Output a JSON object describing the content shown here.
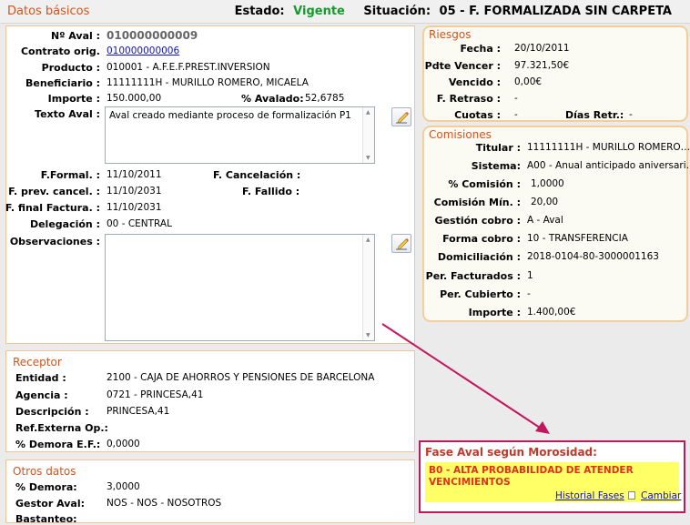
{
  "header": {
    "title": "Datos básicos",
    "estado_label": "Estado:",
    "estado_value": "Vigente",
    "situacion_label": "Situación:",
    "situacion_value": "05 - F. FORMALIZADA SIN CARPETA"
  },
  "main": {
    "naval_label": "Nº Aval :",
    "naval_value": "010000000009",
    "contrato_label": "Contrato orig.",
    "contrato_value": "010000000006",
    "producto_label": "Producto :",
    "producto_value": "010001 - A.F.E.F.PREST.INVERSION",
    "beneficiario_label": "Beneficiario :",
    "beneficiario_value": "11111111H - MURILLO ROMERO, MICAELA",
    "importe_label": "Importe :",
    "importe_value": "150.000,00",
    "avalado_label": "% Avalado:",
    "avalado_value": "52,6785",
    "texto_label": "Texto Aval :",
    "texto_value": "Aval creado mediante proceso de formalización P1",
    "fformal_label": "F.Formal. :",
    "fformal_value": "11/10/2011",
    "fcancel_label": "F. Cancelación :",
    "fcancel_value": "",
    "fprev_label": "F. prev. cancel. :",
    "fprev_value": "11/10/2031",
    "ffallido_label": "F. Fallido :",
    "ffallido_value": "",
    "ffinal_label": "F. final Factura. :",
    "ffinal_value": "11/10/2031",
    "delegacion_label": "Delegación :",
    "delegacion_value": "00 - CENTRAL",
    "observ_label": "Observaciones :",
    "observ_value": ""
  },
  "receptor": {
    "title": "Receptor",
    "entidad_label": "Entidad :",
    "entidad_value": "2100 - CAJA DE AHORROS Y PENSIONES DE BARCELONA",
    "agencia_label": "Agencia :",
    "agencia_value": "0721 - PRINCESA,41",
    "descripcion_label": "Descripción :",
    "descripcion_value": "PRINCESA,41",
    "refext_label": "Ref.Externa Op.:",
    "refext_value": "",
    "demora_label": "% Demora E.F.:",
    "demora_value": "0,0000"
  },
  "otros": {
    "title": "Otros datos",
    "demora_label": "% Demora:",
    "demora_value": "3,0000",
    "gestor_label": "Gestor Aval:",
    "gestor_value": "NOS - NOS - NOSOTROS",
    "bastanteo_label": "Bastanteo:"
  },
  "riesgos": {
    "title": "Riesgos",
    "fecha_label": "Fecha :",
    "fecha_value": "20/10/2011",
    "pdte_label": "Pdte Vencer :",
    "pdte_value": "97.321,50€",
    "vencido_label": "Vencido :",
    "vencido_value": "0,00€",
    "fretraso_label": "F. Retraso :",
    "fretraso_value": "-",
    "cuotas_label": "Cuotas :",
    "cuotas_value": "-",
    "diasretr_label": "Días Retr.:",
    "diasretr_value": "-"
  },
  "comisiones": {
    "title": "Comisiones",
    "titular_label": "Titular :",
    "titular_value": "11111111H - MURILLO ROMERO…",
    "sistema_label": "Sistema:",
    "sistema_value": "A00 - Anual anticipado aniversari…",
    "pcomision_label": "% Comisión :",
    "pcomision_value": "1,0000",
    "cmin_label": "Comisión Mín. :",
    "cmin_value": "20,00",
    "gestion_label": "Gestión cobro :",
    "gestion_value": "A - Aval",
    "forma_label": "Forma cobro :",
    "forma_value": "10 - TRANSFERENCIA",
    "domic_label": "Domiciliación :",
    "domic_value": "2018-0104-80-3000001163",
    "perfact_label": "Per. Facturados :",
    "perfact_value": "1",
    "percub_label": "Per. Cubierto :",
    "percub_value": "-",
    "importe_label": "Importe :",
    "importe_value": "1.400,00€"
  },
  "fase": {
    "title": "Fase Aval según Morosidad:",
    "value": "B0 - ALTA PROBABILIDAD DE ATENDER VENCIMIENTOS",
    "historial_link": "Historial Fases",
    "cambiar_link": "Cambiar"
  },
  "colors": {
    "accent": "#d4531c",
    "estado": "#159a2d",
    "annotation": "#c2185b",
    "highlight": "#ffff66"
  }
}
